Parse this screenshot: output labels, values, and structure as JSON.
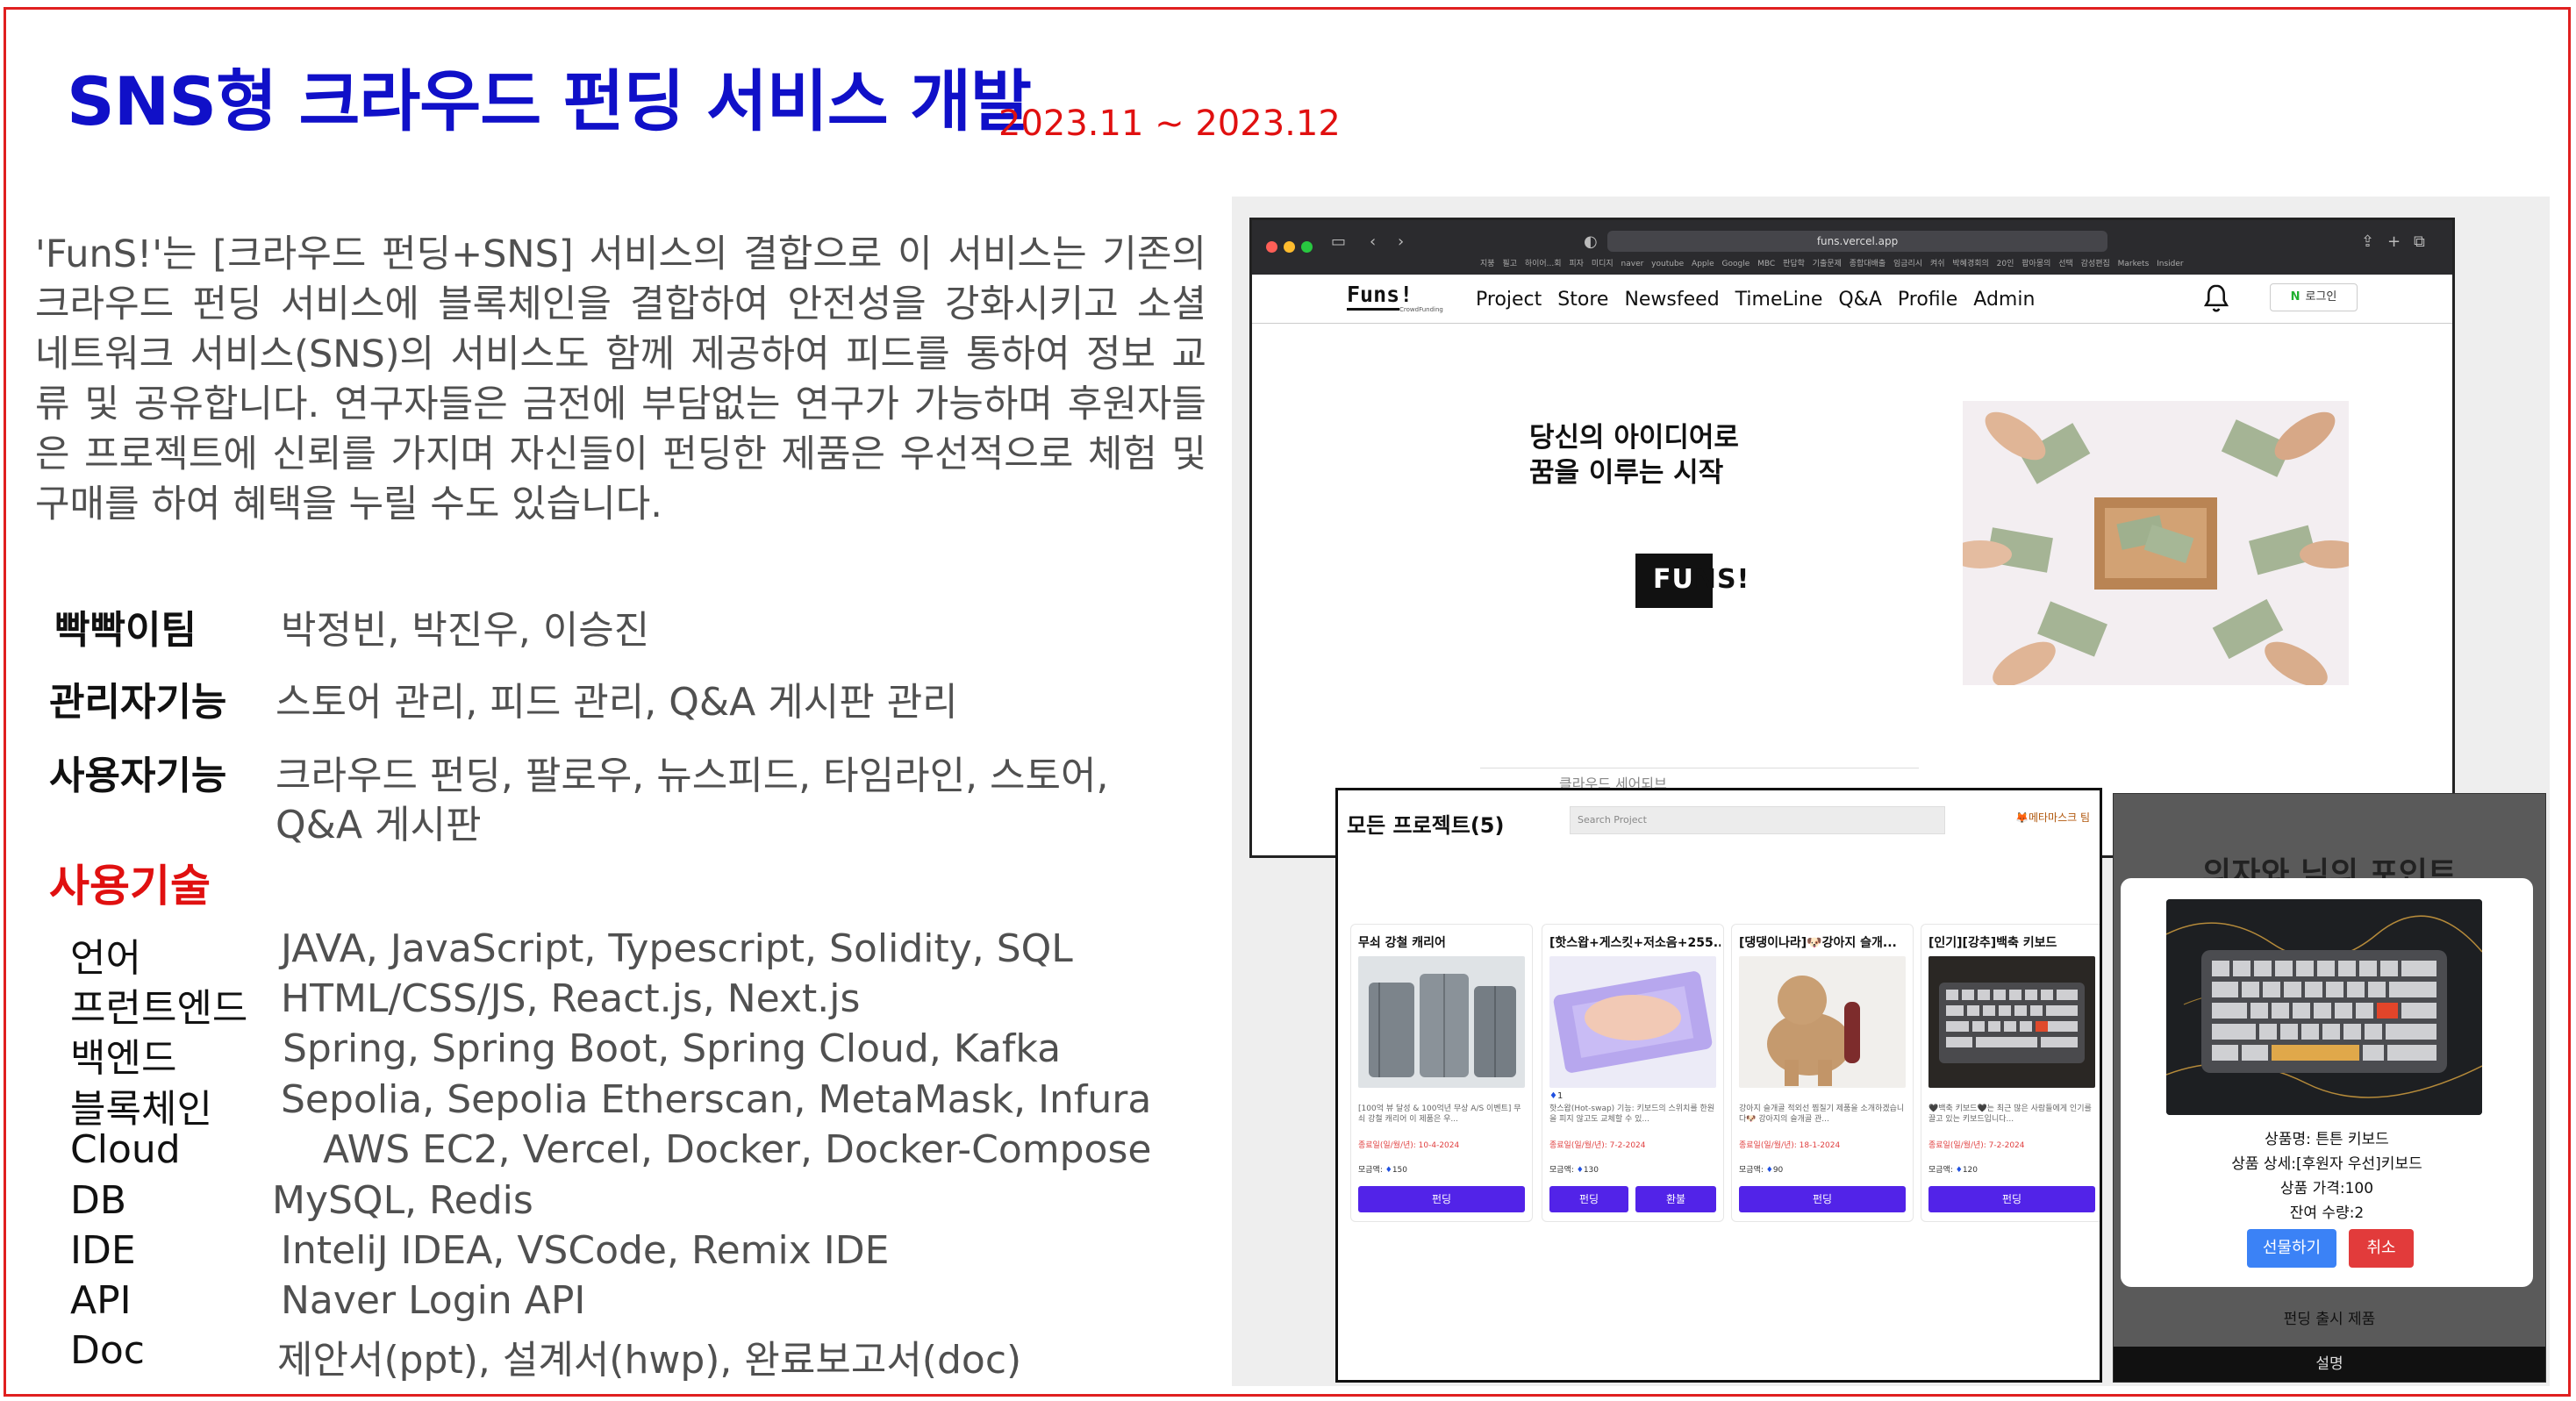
{
  "slide": {
    "title": "SNS형 크라우드 펀딩 서비스 개발",
    "period": "2023.11 ~ 2023.12",
    "description": "'FunS!'는 [크라우드 펀딩+SNS] 서비스의 결합으로 이 서비스는 기존의 크라우드 펀딩 서비스에 블록체인을 결합하여 안전성을 강화시키고 소셜 네트워크 서비스(SNS)의 서비스도 함께 제공하여 피드를 통하여 정보 교류 및 공유합니다.   연구자들은 금전에 부담없는 연구가 가능하며 후원자들은 프로젝트에 신뢰를 가지며 자신들이 펀딩한 제품은 우선적으로 체험 및 구매를 하여 혜택을 누릴 수도 있습니다.",
    "info": [
      {
        "label": "빡빡이팀",
        "value": "박정빈, 박진우, 이승진"
      },
      {
        "label": "관리자기능",
        "value": "스토어 관리, 피드 관리, Q&A 게시판 관리"
      },
      {
        "label": "사용자기능",
        "value": "크라우드 펀딩, 팔로우, 뉴스피드, 타임라인,  스토어,",
        "value2": "Q&A 게시판"
      }
    ],
    "tech_heading": "사용기술",
    "tech": [
      {
        "label": "언어",
        "value": "JAVA, JavaScript, Typescript, Solidity, SQL"
      },
      {
        "label": "프런트엔드",
        "value": "HTML/CSS/JS, React.js, Next.js"
      },
      {
        "label": "백엔드",
        "value": "Spring, Spring Boot, Spring Cloud, Kafka"
      },
      {
        "label": "블록체인",
        "value": "Sepolia, Sepolia Etherscan, MetaMask, Infura"
      },
      {
        "label": "Cloud",
        "value": "AWS EC2, Vercel, Docker, Docker-Compose"
      },
      {
        "label": "DB",
        "value": "MySQL, Redis"
      },
      {
        "label": "IDE",
        "value": "InteliJ IDEA, VSCode, Remix IDE"
      },
      {
        "label": "API",
        "value": "Naver Login API"
      },
      {
        "label": "Doc",
        "value": "제안서(ppt), 설계서(hwp), 완료보고서(doc)"
      }
    ]
  },
  "browser": {
    "url": "funs.vercel.app",
    "bookmarks": "지붕 필고 하이어...회 피자 미디지   naver   youtube   Apple   Google   MBC   판답학 기출문제   종합대배출   임금리시 켜쉬   박혜경회의   20인 팝아몽의 선택 감성편집   Markets Insider",
    "logo": "Funs!",
    "logo_sub": "CrowdFunding",
    "menu": [
      "Project",
      "Store",
      "Newsfeed",
      "TimeLine",
      "Q&A",
      "Profile",
      "Admin"
    ],
    "login_n": "N",
    "login": "로그인",
    "hero_line1": "당신의 아이디어로",
    "hero_line2": "꿈을 이루는 시작",
    "hero_logo_a": "FU",
    "hero_logo_b": "NS!",
    "strip_text": "클라우드 세어되브"
  },
  "projects": {
    "title": "모든 프로젝트(5)",
    "search_placeholder": "Search Project",
    "metamask": "메타마스크 팀",
    "cards": [
      {
        "title": "무쇠 강철 캐리어",
        "desc": "[100억 뷰 달성 & 100억년 무상 A/S 이벤트] 무쇠 강철 캐리어 이 제품은 우...",
        "date": "종료일(일/월/년): 10-4-2024",
        "amount_label": "모금액:",
        "amount": "150",
        "btn": "펀딩"
      },
      {
        "title": "[핫스왑+게스킷+저소음+255...",
        "badge": "1",
        "desc": "핫스왑(Hot-swap) 기능: 키보드의 스위치를 한원을 피지 않고도 교체할 수 있...",
        "date": "종료일(일/월/년): 7-2-2024",
        "amount_label": "모금액:",
        "amount": "130",
        "btn": "펀딩",
        "btn2": "환불"
      },
      {
        "title": "[댕댕이나라]🐶강아지 슬개...",
        "desc": "강아지 슬개골 적외선 찜질기 제품을 소개하겠습니다🐶 강아지의 슬개골 관...",
        "date": "종료일(일/월/년): 18-1-2024",
        "amount_label": "모금액:",
        "amount": "90",
        "btn": "펀딩"
      },
      {
        "title": "[인기][강추]백축 키보드",
        "desc": "🖤백축 키보드🖤는 최근 많은 사람들에게 인기를 끌고 있는 키보드입니다...",
        "date": "종료일(일/월/년): 7-2-2024",
        "amount_label": "모금액:",
        "amount": "120",
        "btn": "펀딩"
      }
    ]
  },
  "product": {
    "heading": "의자와 닉의 포인트",
    "lines": [
      "상품명: 튼튼 키보드",
      "상품 상세:[후원자 우선]키보드",
      "상품 가격:100",
      "잔여 수량:2"
    ],
    "gift": "선물하기",
    "cancel": "취소",
    "footer": "펀딩 출시 제품",
    "desc": "설명"
  },
  "colors": {
    "title": "#1010c8",
    "accent_red": "#e01010",
    "fund_button": "#5223e8"
  }
}
